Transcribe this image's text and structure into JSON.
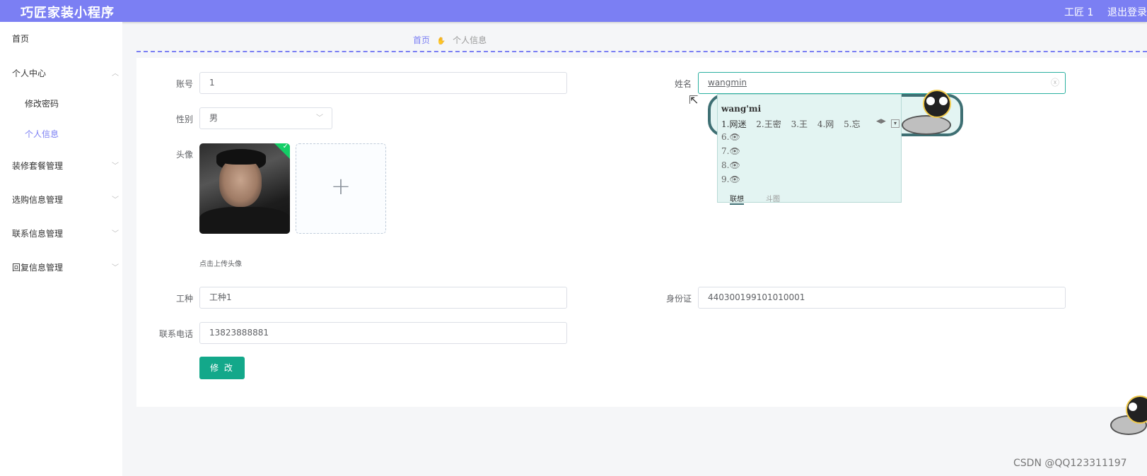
{
  "header": {
    "title": "巧匠家装小程序",
    "user": "工匠 1",
    "logout": "退出登录"
  },
  "sidebar": {
    "items": [
      {
        "label": "首页"
      },
      {
        "label": "个人中心"
      },
      {
        "label": "修改密码"
      },
      {
        "label": "个人信息"
      },
      {
        "label": "装修套餐管理"
      },
      {
        "label": "选购信息管理"
      },
      {
        "label": "联系信息管理"
      },
      {
        "label": "回复信息管理"
      }
    ]
  },
  "breadcrumb": {
    "home": "首页",
    "current": "个人信息"
  },
  "form": {
    "account_label": "账号",
    "account_value": "1",
    "name_label": "姓名",
    "name_value": "wangmin",
    "gender_label": "性别",
    "gender_value": "男",
    "avatar_label": "头像",
    "upload_hint": "点击上传头像",
    "job_label": "工种",
    "job_value": "工种1",
    "id_label": "身份证",
    "id_value": "440300199101010001",
    "phone_label": "联系电话",
    "phone_value": "13823888881",
    "submit_label": "修 改"
  },
  "ime": {
    "pinyin": "wang'mi",
    "candidates": [
      "1.网迷",
      "2.王密",
      "3.王",
      "4.网",
      "5.忘"
    ],
    "rows": [
      "6.",
      "7.",
      "8.",
      "9."
    ],
    "tabs": [
      "联想",
      "斗图"
    ]
  },
  "watermark": "CSDN @QQ123311197",
  "colors": {
    "header_bg": "#7b7ff3",
    "accent": "#7b7ff3",
    "submit_button": "#13a88a",
    "focus_border": "#2bb0a0",
    "ime_bg": "#e3f4f2"
  }
}
